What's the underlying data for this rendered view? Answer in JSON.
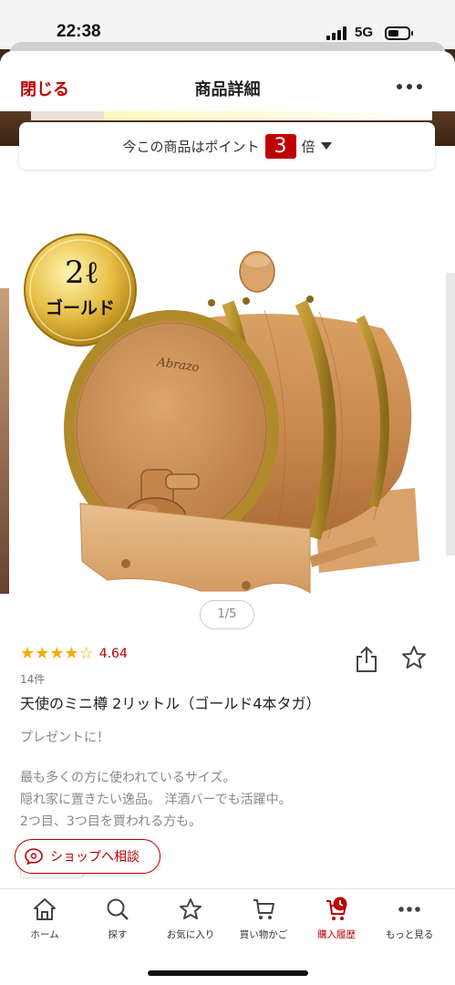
{
  "status_bar": {
    "time": "22:38",
    "network": "5G"
  },
  "header": {
    "close_label": "閉じる",
    "title": "商品詳細"
  },
  "points_banner": {
    "prefix": "今この商品はポイント",
    "multiplier": "3",
    "suffix": "倍"
  },
  "product_image": {
    "badge_line1": "2ℓ",
    "badge_line2": "ゴールド",
    "barrel_text": "Abrazo"
  },
  "pager": {
    "label": "1/5"
  },
  "rating": {
    "value": "4.64",
    "review_count": "14件",
    "stars": 4.5
  },
  "product": {
    "title": "天使のミニ樽 2リットル（ゴールド4本タガ）",
    "desc_1": "プレゼントに！",
    "desc_2": "最も多くの方に使われているサイズ。",
    "desc_3": " 隠れ家に置きたい逸品。 洋酒バーでも活躍中。",
    "desc_4": "2つ目、3つ目を買われる方も。"
  },
  "consult_button": {
    "label": "ショップへ相談"
  },
  "tab_bar": {
    "home": "ホーム",
    "search": "探す",
    "favorites": "お気に入り",
    "cart": "買い物かご",
    "history": "購入履歴",
    "more": "もっと見る"
  },
  "colors": {
    "brand": "#bf0000",
    "star": "#f6ab00"
  }
}
